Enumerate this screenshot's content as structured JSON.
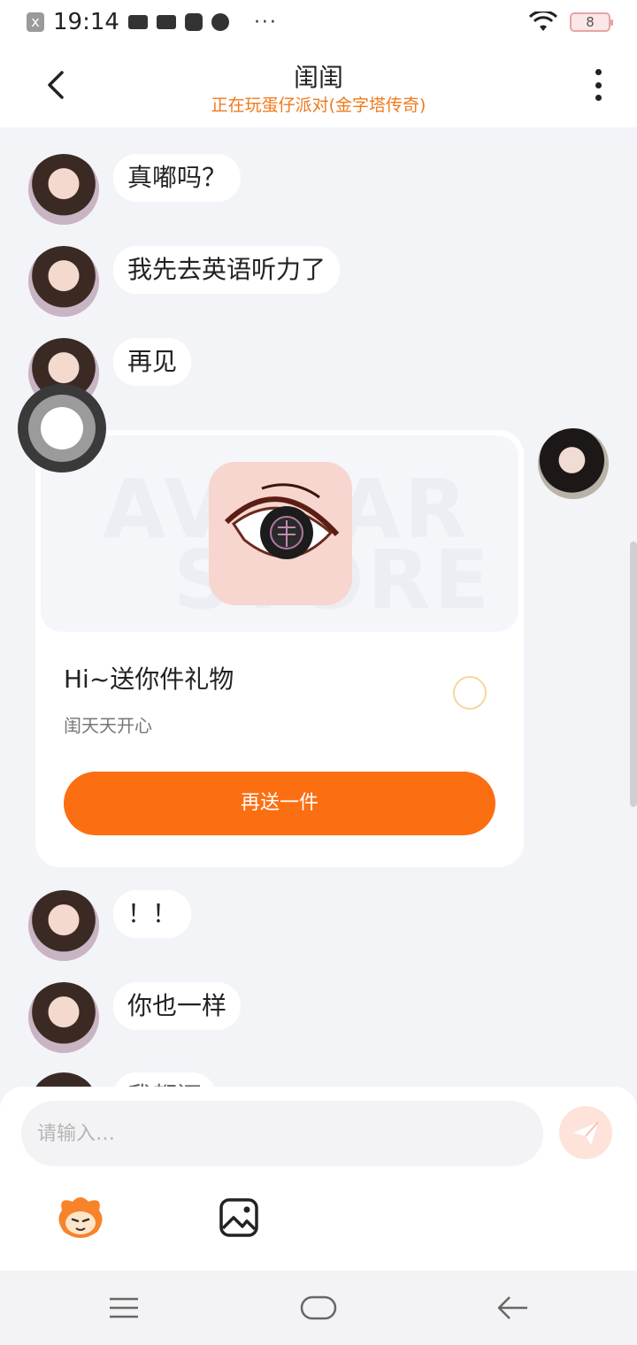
{
  "status_bar": {
    "time": "19:14",
    "notif_badge": "x",
    "more": "···",
    "battery": "8"
  },
  "header": {
    "title": "闺闺",
    "subtitle": "正在玩蛋仔派对(金字塔传奇)"
  },
  "messages": [
    {
      "side": "left",
      "text": "真嘟吗？"
    },
    {
      "side": "left",
      "text": "我先去英语听力了"
    },
    {
      "side": "left",
      "text": "再见"
    },
    {
      "side": "left",
      "text": "！！"
    },
    {
      "side": "left",
      "text": "你也一样"
    },
    {
      "side": "left",
      "text": "我都还"
    }
  ],
  "gift_card": {
    "watermark_1": "AVATAR",
    "watermark_2": "STORE",
    "title": "Hi~送你件礼物",
    "subtitle": "闺天天开心",
    "button_label": "再送一件"
  },
  "input": {
    "placeholder": "请输入…",
    "value": ""
  },
  "icons": {
    "accent": "#fb6f12",
    "subtitle_color": "#f07a1c"
  }
}
